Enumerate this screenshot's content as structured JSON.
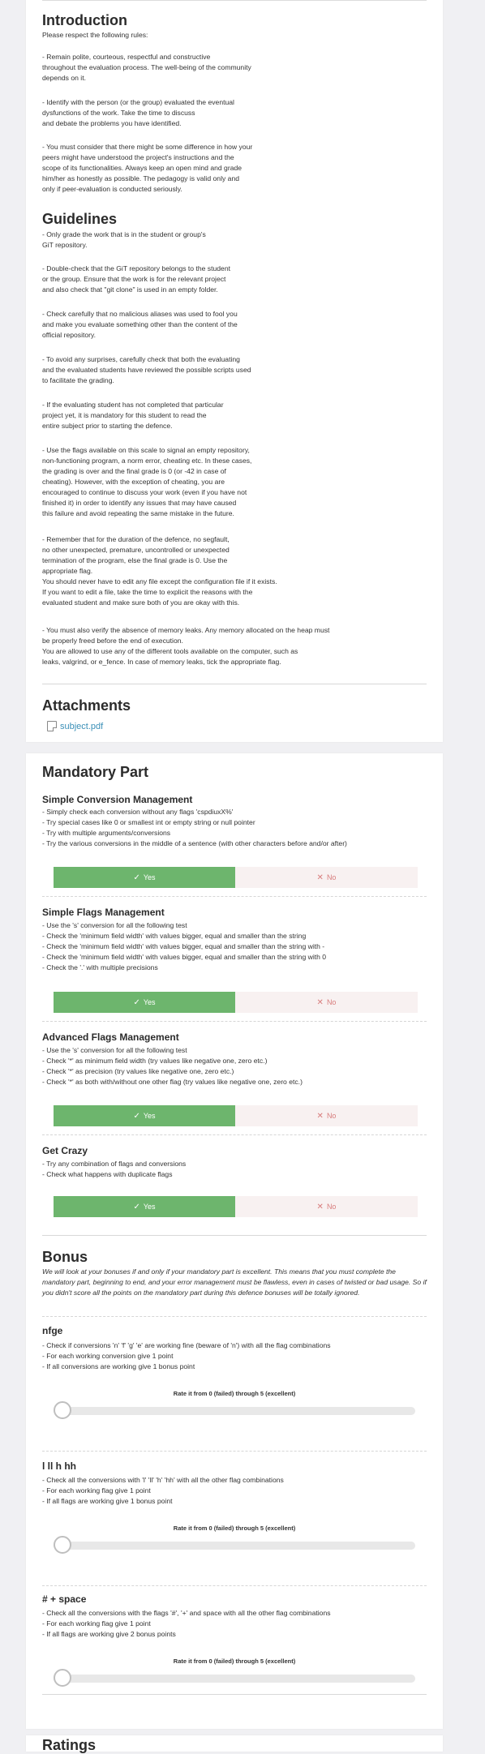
{
  "introduction": {
    "title": "Introduction",
    "lead": "Please respect the following rules:",
    "rules": [
      "- Remain polite, courteous, respectful and constructive\nthroughout the evaluation process. The well-being of the community\ndepends on it.",
      "- Identify with the person (or the group) evaluated the eventual\ndysfunctions of the work. Take the time to discuss\nand debate the problems you have identified.",
      "- You must consider that there might be some difference in how your\npeers might have understood the project's instructions and the\nscope of its functionalities. Always keep an open mind and grade\nhim/her as honestly as possible. The pedagogy is valid only and\nonly if peer-evaluation is conducted seriously."
    ]
  },
  "guidelines": {
    "title": "Guidelines",
    "items": [
      "- Only grade the work that is in the student or group's\nGiT repository.",
      "- Double-check that the GiT repository belongs to the student\nor the group. Ensure that the work is for the relevant project\nand also check that \"git clone\" is used in an empty folder.",
      "- Check carefully that no malicious aliases was used to fool you\nand make you evaluate something other than the content of the\nofficial repository.",
      "- To avoid any surprises, carefully check that both the evaluating\nand the evaluated students have reviewed the possible scripts used\nto facilitate the grading.",
      "- If the evaluating student has not completed that particular\nproject yet, it is mandatory for this student to read the\nentire subject prior to starting the defence.",
      "- Use the flags available on this scale to signal an empty repository,\nnon-functioning program, a norm error, cheating etc. In these cases,\nthe grading is over and the final grade is 0 (or -42 in case of\ncheating). However, with the exception of cheating, you are\nencouraged to continue to discuss your work (even if you have not\nfinished it) in order to identify any issues that may have caused\nthis failure and avoid repeating the same mistake in the future.",
      "- Remember that for the duration of the defence, no segfault,\nno other unexpected, premature, uncontrolled or unexpected\ntermination of the program, else the final grade is 0. Use the\nappropriate flag.\nYou should never have to edit any file except the configuration file if it exists.\nIf you want to edit a file, take the time to explicit the reasons with the\nevaluated student and make sure both of you are okay with this.",
      "- You must also verify the absence of memory leaks. Any memory allocated on the heap must\nbe properly freed before the end of execution.\nYou are allowed to use any of the different tools available on the computer, such as\nleaks, valgrind, or e_fence. In case of memory leaks, tick the appropriate flag."
    ]
  },
  "attachments": {
    "title": "Attachments",
    "file_icon": "file-icon",
    "file_name": "subject.pdf"
  },
  "mandatory": {
    "title": "Mandatory Part",
    "yes_label": "Yes",
    "no_label": "No",
    "yes_icon": "check-icon",
    "no_icon": "cross-icon",
    "sections": [
      {
        "title": "Simple Conversion Management",
        "text": "- Simply check each conversion without any flags 'cspdiuxX%'\n- Try special cases like 0 or smallest int or empty string or null pointer\n- Try with multiple arguments/conversions\n- Try the various conversions in the middle of a sentence (with other characters before and/or after)"
      },
      {
        "title": "Simple Flags Management",
        "text": "- Use the 's' conversion for all the following test\n- Check the 'minimum field width' with values bigger, equal and smaller than the string\n- Check the 'minimum field width' with values bigger, equal and smaller than the string with -\n- Check the 'minimum field width' with values bigger, equal and smaller than the string with 0\n- Check the '.' with multiple precisions"
      },
      {
        "title": "Advanced Flags Management",
        "text": "- Use the 's' conversion for all the following test\n- Check '*' as minimum field width (try values like negative one, zero etc.)\n- Check '*' as precision (try values like negative one, zero etc.)\n- Check '*' as both with/without one other flag (try values like negative one, zero etc.)"
      },
      {
        "title": "Get Crazy",
        "text": "- Try any combination of flags and conversions\n- Check what happens with duplicate flags"
      }
    ]
  },
  "bonus": {
    "title": "Bonus",
    "intro": "We will look at your bonuses if and only if your mandatory part is excellent. This means that you must complete the mandatory part, beginning to end, and your error management must be flawless, even in cases of twisted or bad usage. So if you didn't score all the points on the mandatory part during this defence bonuses will be totally ignored.",
    "rate_label": "Rate it from 0 (failed) through 5 (excellent)",
    "sections": [
      {
        "title": "nfge",
        "text": "- Check if conversions 'n' 'f' 'g' 'e' are working fine (beware of 'n') with all the flag combinations\n- For each working conversion give 1 point\n- If all conversions are working give 1 bonus point",
        "rating": 0
      },
      {
        "title": "l ll h hh",
        "text": "- Check all the conversions with 'l' 'll' 'h' 'hh' with all the other flag combinations\n- For each working flag give 1 point\n- If all flags are working give 1 bonus point",
        "rating": 0
      },
      {
        "title": "# + space",
        "text": "- Check all the conversions with the flags '#', '+' and space with all the other flag combinations\n- For each working flag give 1 point\n- If all flags are working give 2 bonus points",
        "rating": 0
      }
    ]
  },
  "ratings": {
    "title": "Ratings"
  }
}
